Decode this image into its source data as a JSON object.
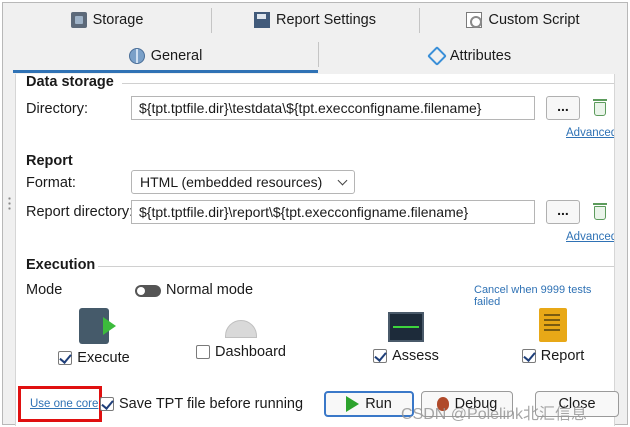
{
  "tabs_top": [
    {
      "label": "Storage",
      "icon": "storage-icon"
    },
    {
      "label": "Report Settings",
      "icon": "report-settings-icon"
    },
    {
      "label": "Custom Script",
      "icon": "custom-script-icon"
    }
  ],
  "tabs_second": [
    {
      "label": "General",
      "icon": "globe-icon",
      "active": true
    },
    {
      "label": "Attributes",
      "icon": "tag-icon",
      "active": false
    }
  ],
  "data_storage": {
    "title": "Data storage",
    "directory_label": "Directory:",
    "directory_value": "${tpt.tptfile.dir}\\testdata\\${tpt.execconfigname.filename}",
    "browse_label": "...",
    "advanced_link": "Advanced"
  },
  "report": {
    "title": "Report",
    "format_label": "Format:",
    "format_value": "HTML (embedded resources)",
    "report_dir_label": "Report directory:",
    "report_dir_value": "${tpt.tptfile.dir}\\report\\${tpt.execconfigname.filename}",
    "browse_label": "...",
    "advanced_link": "Advanced"
  },
  "execution": {
    "title": "Execution",
    "mode_label": "Mode",
    "mode_value": "Normal mode",
    "cancel_link": "Cancel when 9999 tests failed"
  },
  "actions": [
    {
      "label": "Execute",
      "checked": true,
      "icon": "execute-icon"
    },
    {
      "label": "Dashboard",
      "checked": false,
      "icon": "dashboard-icon"
    },
    {
      "label": "Assess",
      "checked": true,
      "icon": "assess-icon"
    },
    {
      "label": "Report",
      "checked": true,
      "icon": "report-icon"
    }
  ],
  "bottom": {
    "use_one_core_link": "Use one core",
    "save_tpt_label": "Save TPT file before running",
    "save_tpt_checked": true,
    "run_label": "Run",
    "debug_label": "Debug",
    "close_label": "Close",
    "watermark": "CSDN @Polelink北汇信息"
  },
  "colors": {
    "accent": "#2f72b5",
    "highlight_box": "#e01010",
    "run_icon": "#2da32d"
  }
}
